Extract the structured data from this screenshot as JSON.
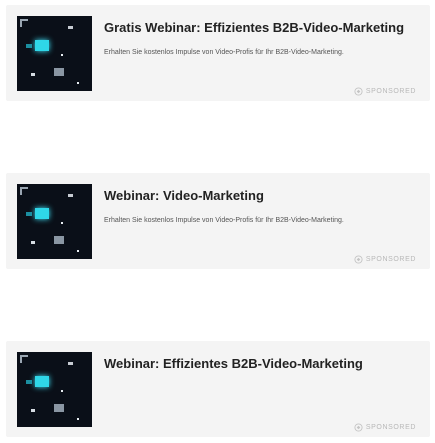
{
  "ads": [
    {
      "title": "Gratis Webinar: Effizientes B2B-Video-Marketing",
      "description": "Erhalten Sie kostenlos Impulse von Video-Profis für Ihr B2B-Video-Marketing.",
      "sponsored_label": "SPONSORED",
      "thumbnail_icon": "video-thumbnail-image"
    },
    {
      "title": "Webinar: Video-Marketing",
      "description": "Erhalten Sie kostenlos Impulse von Video-Profis für Ihr B2B-Video-Marketing.",
      "sponsored_label": "SPONSORED",
      "thumbnail_icon": "video-thumbnail-image"
    },
    {
      "title": "Webinar: Effizientes B2B-Video-Marketing",
      "description": "",
      "sponsored_label": "SPONSORED",
      "thumbnail_icon": "video-thumbnail-image"
    }
  ],
  "colors": {
    "card_background": "#f4f4f4",
    "title_text": "#222222",
    "description_text": "#555555",
    "sponsored_text": "#b8b8b8",
    "thumbnail_accent": "#2fd7e8"
  }
}
